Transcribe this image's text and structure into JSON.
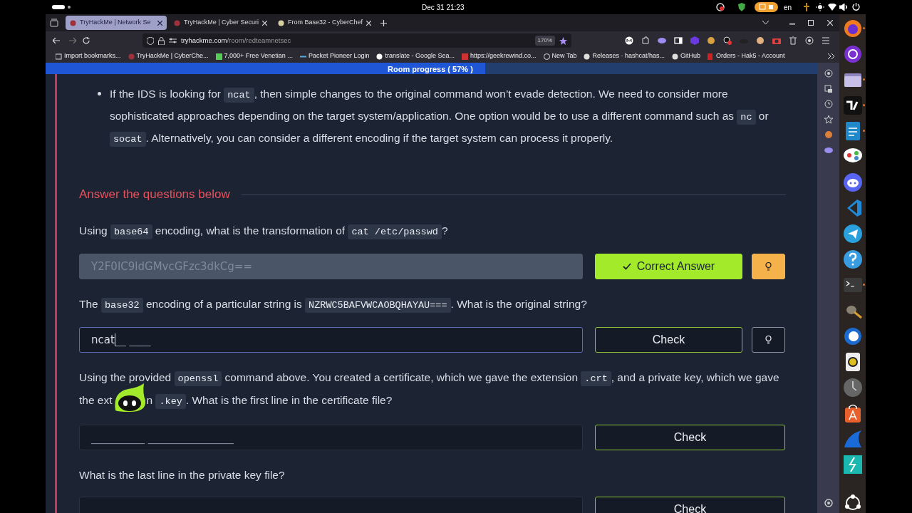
{
  "top_bar": {
    "clock": "Dec 31  21:23",
    "language": "en"
  },
  "browser": {
    "tabs": [
      {
        "label": "TryHackMe | Network Se",
        "selected": true
      },
      {
        "label": "TryHackMe | Cyber Securi",
        "selected": false
      },
      {
        "label": "From Base32 - CyberChef",
        "selected": false
      }
    ],
    "url": {
      "host": "tryhackme.com",
      "path": "/room/redteamnetsec"
    },
    "zoom": "170%",
    "bookmarks": [
      "Import bookmarks...",
      "TryHackMe | CyberChe...",
      "7,000+ Free Venetian ...",
      "Packet Pioneer Login",
      "translate - Google Sea...",
      "https://geekrewind.co...",
      "New Tab",
      "Releases · hashcat/has...",
      "GitHub",
      "Orders - Hak5 - Account"
    ]
  },
  "page": {
    "progress": {
      "label": "Room progress ( 57% )",
      "level": 0.57
    },
    "bullet": [
      {
        "kind": "text",
        "text": "If the IDS is looking for "
      },
      {
        "kind": "code",
        "text": "ncat"
      },
      {
        "kind": "text",
        "text": ", then simple changes to the original command won’t evade detection. We need to consider more sophisticated approaches depending on the target system/application. One option would be to use a different command such as "
      },
      {
        "kind": "code",
        "text": "nc"
      },
      {
        "kind": "text",
        "text": " or "
      },
      {
        "kind": "code",
        "text": "socat"
      },
      {
        "kind": "text",
        "text": ". Alternatively, you can consider a different encoding if the target system can process it properly."
      }
    ],
    "heading": "Answer the questions below",
    "questions": [
      {
        "prompt": [
          {
            "kind": "text",
            "text": "Using "
          },
          {
            "kind": "code",
            "text": "base64"
          },
          {
            "kind": "text",
            "text": " encoding, what is the transformation of "
          },
          {
            "kind": "code",
            "text": "cat /etc/passwd"
          },
          {
            "kind": "text",
            "text": "?"
          }
        ],
        "answer": {
          "value": "Y2F0IC9ldGMvcGFzc3dkCg==",
          "disabled": true
        },
        "button": "Correct Answer",
        "correct": true,
        "hint": true
      },
      {
        "prompt": [
          {
            "kind": "text",
            "text": "The "
          },
          {
            "kind": "code",
            "text": "base32"
          },
          {
            "kind": "text",
            "text": " encoding of a particular string is "
          },
          {
            "kind": "code",
            "text": "NZRWC5BAFVWCAOBQHAYAU==="
          },
          {
            "kind": "text",
            "text": ". What is the original string?"
          }
        ],
        "answer": {
          "value": "ncat",
          "placeholder": "__ ____",
          "focused": true
        },
        "button": "Check",
        "correct": false,
        "hint": true
      },
      {
        "prompt": [
          {
            "kind": "text",
            "text": "Using the provided "
          },
          {
            "kind": "code",
            "text": "openssl"
          },
          {
            "kind": "text",
            "text": " command above. You created a certificate, which we gave the extension "
          },
          {
            "kind": "code",
            "text": ".crt"
          },
          {
            "kind": "text",
            "text": ", and a private key, which we gave the ext"
          },
          {
            "kind": "mascot"
          },
          {
            "kind": "text",
            "text": "n "
          },
          {
            "kind": "code",
            "text": ".key"
          },
          {
            "kind": "text",
            "text": ". What is the first line in the certificate file?"
          }
        ],
        "answer": {
          "placeholder": "__________ ________________",
          "focused": false
        },
        "button": "Check",
        "correct": false,
        "hint": false
      },
      {
        "prompt": [
          {
            "kind": "text",
            "text": "What is the last line in the private key file?"
          }
        ],
        "answer": {
          "focused": false
        },
        "button": "Check",
        "correct": false,
        "hint": false
      }
    ]
  },
  "dock": [
    {
      "running": true
    },
    {
      "running": false
    },
    {
      "running": true
    },
    {
      "running": true
    },
    {
      "running": true
    },
    {
      "running": false
    },
    {
      "running": false
    },
    {
      "running": false
    },
    {
      "running": false
    },
    {
      "running": false
    },
    {
      "running": true
    },
    {
      "running": false
    },
    {
      "running": false
    },
    {
      "running": false
    },
    {
      "running": false
    },
    {
      "running": false
    },
    {
      "running": false
    },
    {
      "running": false
    },
    {
      "running": false
    }
  ]
}
